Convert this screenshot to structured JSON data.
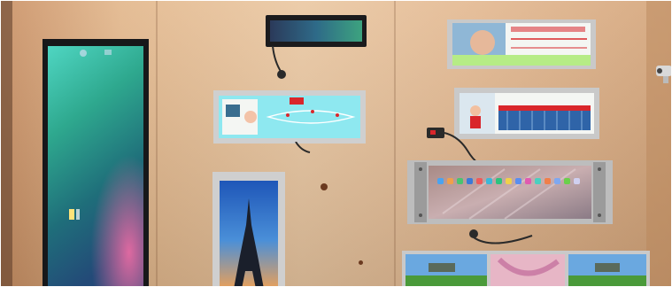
{
  "scene": {
    "kind": "photo",
    "colors": {
      "wall_light": "#e8c29a",
      "wall_mid": "#d9ad82",
      "wall_dark": "#c8956a",
      "bezel_black": "#1b1b1d",
      "bezel_silver": "#c9c9c9",
      "screen_cyan": "#8ee8f0",
      "screen_white": "#f4f6f3",
      "sky_blue": "#4a8fd8",
      "accent_red": "#d9262b"
    }
  }
}
